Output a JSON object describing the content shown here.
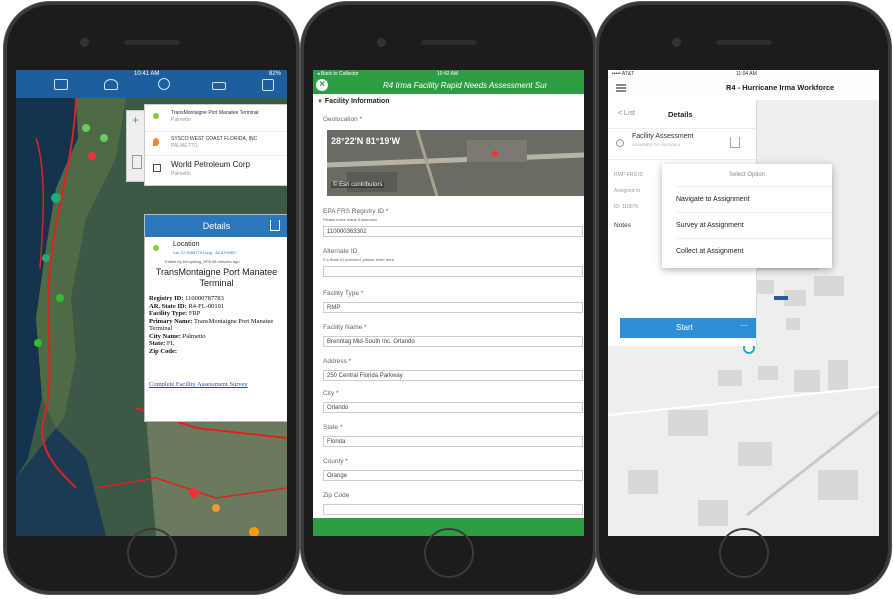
{
  "phone1": {
    "status_time": "10:41 AM",
    "status_battery": "82%",
    "popup_items": [
      {
        "title": "TransMontaigne Port Manatee Terminal",
        "subtitle": "Palmetto"
      },
      {
        "title": "SYSCO WEST COAST FLORIDA, INC",
        "subtitle": "PALMETTO"
      },
      {
        "title": "World Petroleum Corp",
        "subtitle": "Palmetto"
      }
    ],
    "details_title": "Details",
    "location_label": "Location",
    "location_coords": "Lat: 27.6068779  Long: -82.5709957",
    "location_edit": "Edited by bill.spiking_EPA 58 minutes ago",
    "facility_name": "TransMontaigne Port Manatee Terminal",
    "fields": [
      {
        "label": "Registry ID:",
        "value": "110000787783"
      },
      {
        "label": "AR. State ID:",
        "value": "R4-FL-00191"
      },
      {
        "label": "Facility Type:",
        "value": "FRP"
      },
      {
        "label": "Primary Name:",
        "value": "TransMontaigne Port Manatee Terminal"
      },
      {
        "label": "City Name:",
        "value": "Palmetto"
      },
      {
        "label": "State:",
        "value": "FL"
      },
      {
        "label": "Zip Code:",
        "value": ""
      }
    ],
    "survey_link": "Complete Facility Assessment Survey"
  },
  "phone2": {
    "back_label": "◂ Back to Collector",
    "status_time": "10:42 AM",
    "title": "R4 Irma Facility Rapid Needs Assessment Sur",
    "section": "Facility Information",
    "geolocation_label": "Geolocation *",
    "geolocation_value": "28°22'N 81°19'W",
    "map_attribution": "Esri contributors",
    "fields": [
      {
        "label": "EPA FRS Registry ID *",
        "hint": "Please leave blank if unknown",
        "value": "110000363302"
      },
      {
        "label": "Alternate ID",
        "hint": "If a State ID provided, please enter here",
        "value": ""
      },
      {
        "label": "Facility Type *",
        "hint": "",
        "value": "RMP"
      },
      {
        "label": "Facility Name *",
        "hint": "",
        "value": "Brenntag Mid-South Inc. Orlando"
      },
      {
        "label": "Address *",
        "hint": "",
        "value": "250 Central Florida Parkway"
      },
      {
        "label": "City *",
        "hint": "",
        "value": "Orlando"
      },
      {
        "label": "State *",
        "hint": "",
        "value": "Florida"
      },
      {
        "label": "County *",
        "hint": "",
        "value": "Orange"
      },
      {
        "label": "Zip Code",
        "hint": "",
        "value": ""
      }
    ]
  },
  "phone3": {
    "status_carrier": "••••• AT&T",
    "status_time": "11:04 AM",
    "title": "R4 - Hurricane Irma Workforce",
    "list_back": "List",
    "details_label": "Details",
    "assessment_title": "Facility Assessment",
    "assessment_sub": "ASSIGNED TO: REGION 4",
    "menu_title": "Select Option",
    "menu_options": [
      "Navigate to Assignment",
      "Survey at Assignment",
      "Collect at Assignment"
    ],
    "side_labels": [
      "RMP-FRS ID",
      "Assigned to",
      "ID: 110079",
      "Notes"
    ],
    "start_label": "Start"
  },
  "colors": {
    "arcgis_blue": "#1d5f9e",
    "survey_green": "#2e9e44",
    "workforce_blue": "#2d8fd5"
  }
}
